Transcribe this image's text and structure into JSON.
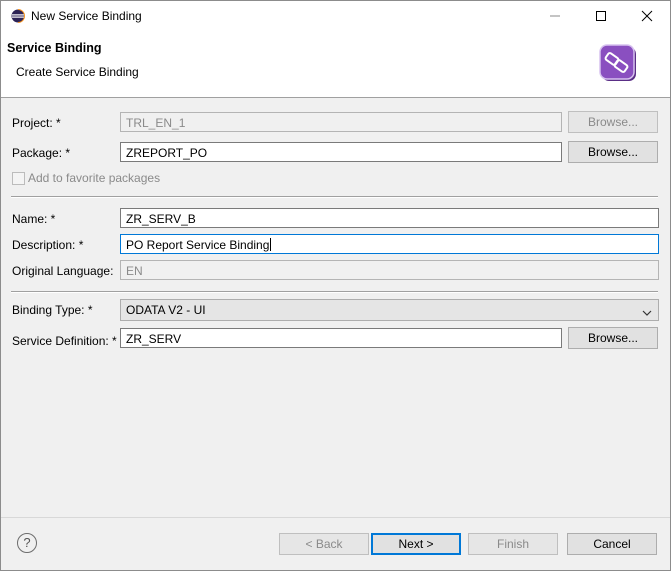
{
  "window": {
    "title": "New Service Binding",
    "controls": [
      "minimize-icon",
      "maximize-icon",
      "close-icon"
    ]
  },
  "header": {
    "title": "Service Binding",
    "subtitle": "Create Service Binding",
    "logo_icon": "service-binding-wizard-icon",
    "logo_color": "#8a4fc0"
  },
  "form": {
    "project": {
      "label": "Project: *",
      "value": "TRL_EN_1",
      "browse": "Browse..."
    },
    "package": {
      "label": "Package: *",
      "value": "ZREPORT_PO",
      "browse": "Browse..."
    },
    "favorite": {
      "label": "Add to favorite packages",
      "checked": false
    },
    "name": {
      "label": "Name: *",
      "value": "ZR_SERV_B"
    },
    "description": {
      "label": "Description: *",
      "value": "PO Report Service Binding"
    },
    "original_language": {
      "label": "Original Language:",
      "value": "EN"
    },
    "binding_type": {
      "label": "Binding Type: *",
      "value": "ODATA V2 - UI"
    },
    "service_definition": {
      "label": "Service Definition: *",
      "value": "ZR_SERV",
      "browse": "Browse..."
    }
  },
  "footer": {
    "help": "?",
    "back": "< Back",
    "next": "Next >",
    "finish": "Finish",
    "cancel": "Cancel"
  }
}
